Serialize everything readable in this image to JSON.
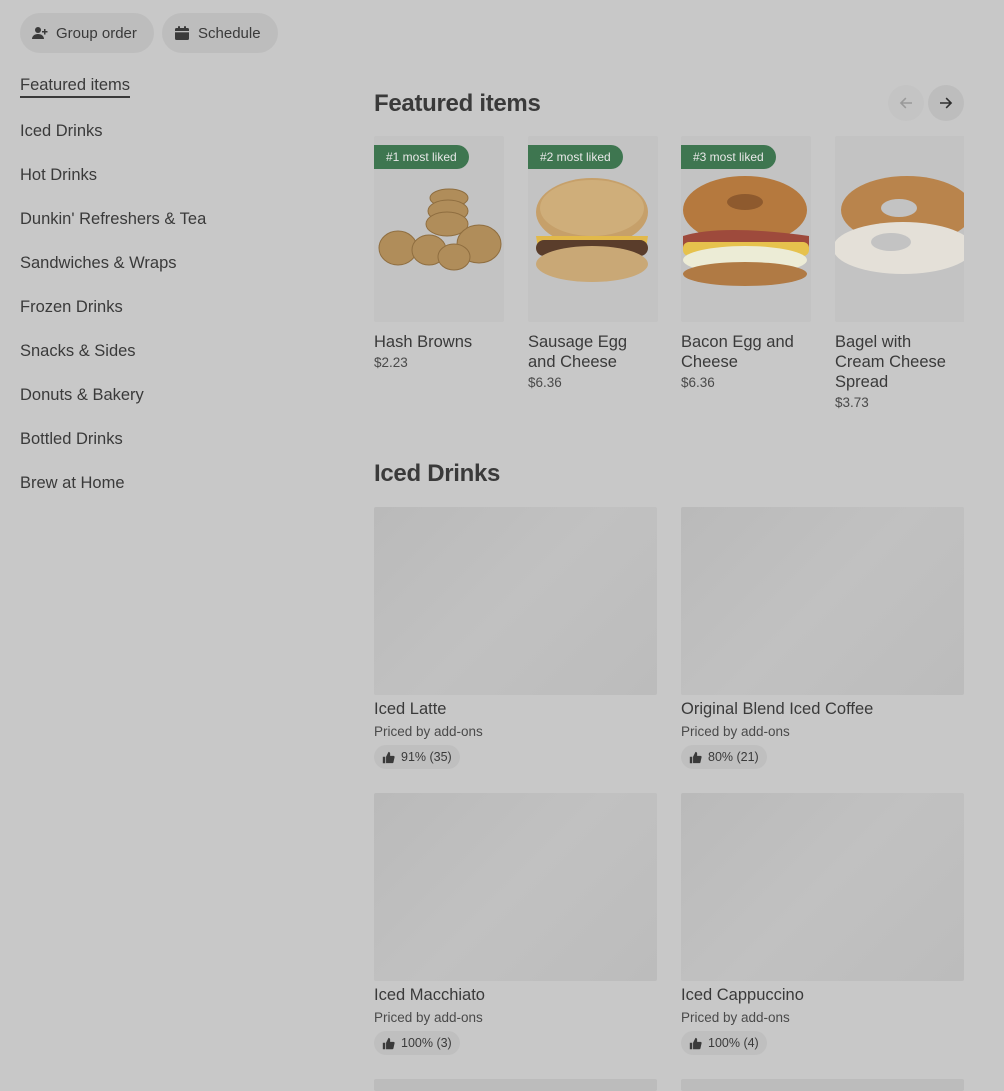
{
  "toolbar": {
    "group_order_label": "Group order",
    "schedule_label": "Schedule"
  },
  "sidebar": {
    "items": [
      {
        "label": "Featured items"
      },
      {
        "label": "Iced Drinks"
      },
      {
        "label": "Hot Drinks"
      },
      {
        "label": "Dunkin' Refreshers & Tea"
      },
      {
        "label": "Sandwiches & Wraps"
      },
      {
        "label": "Frozen Drinks"
      },
      {
        "label": "Snacks & Sides"
      },
      {
        "label": "Donuts & Bakery"
      },
      {
        "label": "Bottled Drinks"
      },
      {
        "label": "Brew at Home"
      }
    ]
  },
  "featured": {
    "title": "Featured items",
    "items": [
      {
        "badge": "#1 most liked",
        "name": "Hash Browns",
        "price": "$2.23"
      },
      {
        "badge": "#2 most liked",
        "name": "Sausage Egg and Cheese",
        "price": "$6.36"
      },
      {
        "badge": "#3 most liked",
        "name": "Bacon Egg and Cheese",
        "price": "$6.36"
      },
      {
        "badge": "",
        "name": "Bagel with Cream Cheese Spread",
        "price": "$3.73"
      }
    ]
  },
  "iced": {
    "title": "Iced Drinks",
    "items": [
      {
        "name": "Iced Latte",
        "sub": "Priced by add-ons",
        "rating": "91% (35)"
      },
      {
        "name": "Original Blend Iced Coffee",
        "sub": "Priced by add-ons",
        "rating": "80% (21)"
      },
      {
        "name": "Iced Macchiato",
        "sub": "Priced by add-ons",
        "rating": "100% (3)"
      },
      {
        "name": "Iced Cappuccino",
        "sub": "Priced by add-ons",
        "rating": "100% (4)"
      }
    ]
  },
  "colors": {
    "overlay_bg": "#c8c8c8",
    "badge_green": "#3e7650"
  }
}
